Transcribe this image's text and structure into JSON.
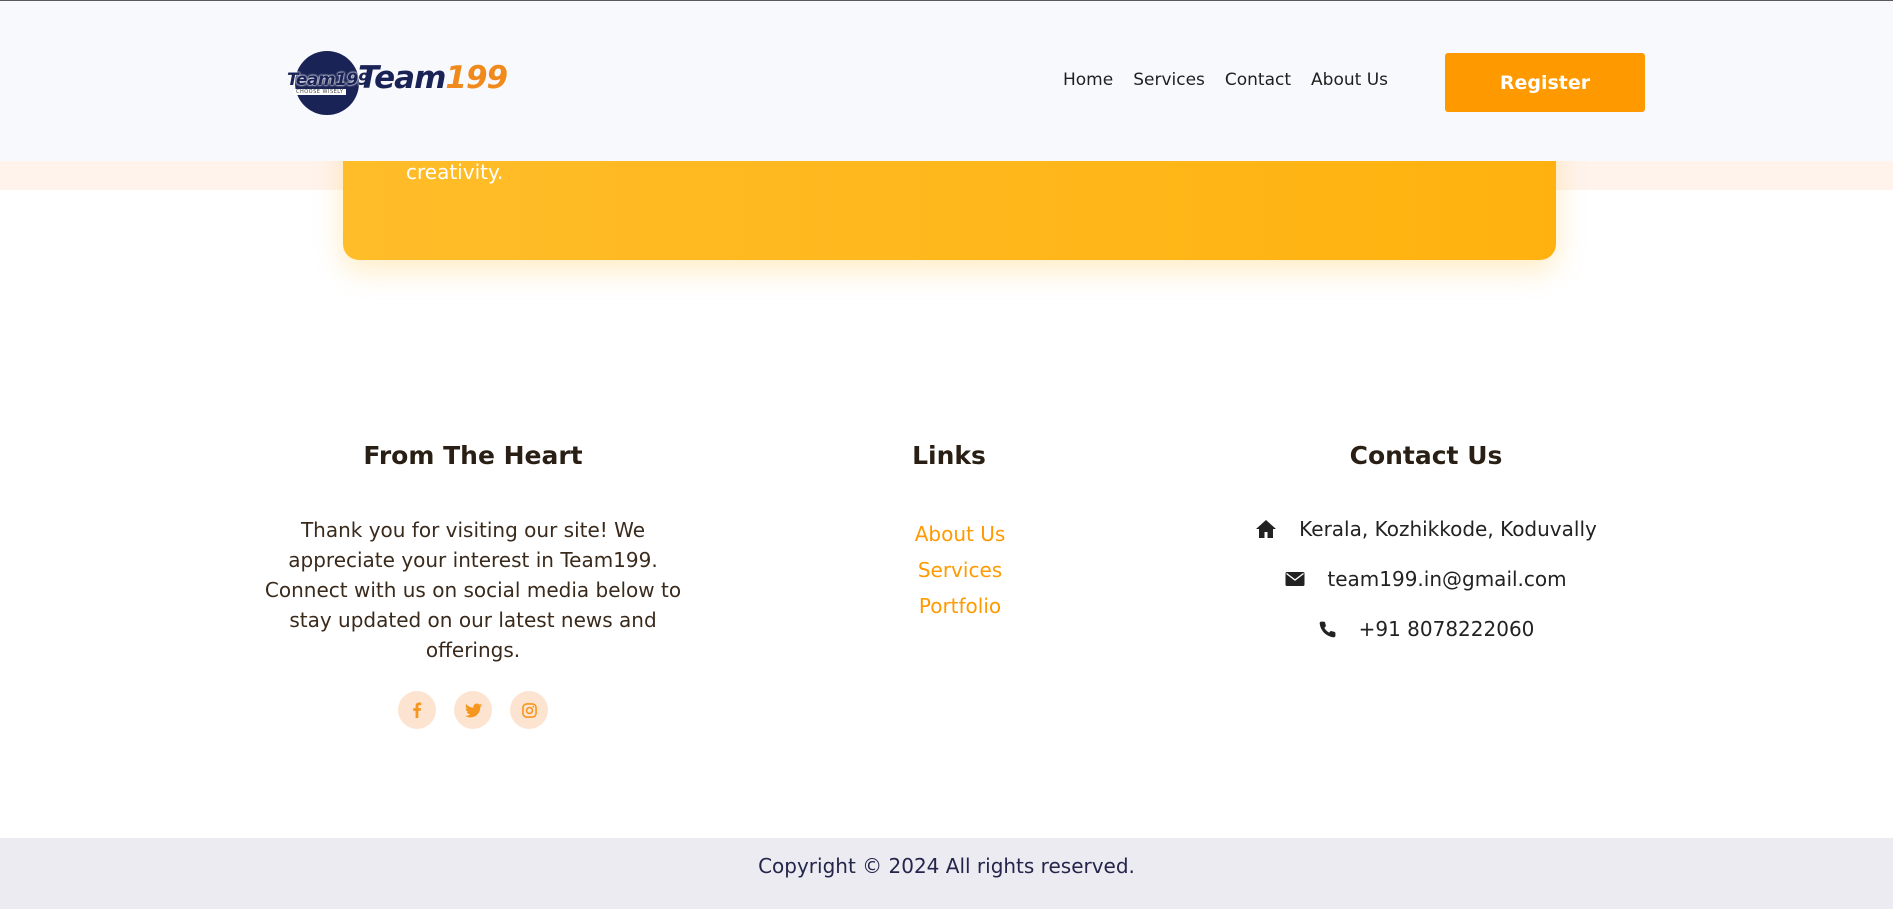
{
  "header": {
    "logo_small": "Team199",
    "logo_sub": "CHOOSE WISELY",
    "logo_big_part1": "Team",
    "logo_big_part2": "199",
    "nav": [
      "Home",
      "Services",
      "Contact",
      "About Us"
    ],
    "register_label": "Register"
  },
  "hero": {
    "text": "creativity."
  },
  "footer": {
    "heart": {
      "title": "From The Heart",
      "text": "Thank you for visiting our site! We appreciate your interest in Team199. Connect with us on social media below to stay updated on our latest news and offerings.",
      "socials": [
        "facebook-icon",
        "twitter-icon",
        "instagram-icon"
      ]
    },
    "links": {
      "title": "Links",
      "items": [
        "About Us",
        "Services",
        "Portfolio"
      ]
    },
    "contact": {
      "title": "Contact Us",
      "address": "Kerala, Kozhikkode, Koduvally",
      "email": "team199.in@gmail.com",
      "phone": "+91 8078222060"
    },
    "copyright": "Copyright © 2024 All rights reserved."
  },
  "colors": {
    "accent": "#ff9900",
    "card": "#ffb20f",
    "navy": "#1a2356"
  }
}
